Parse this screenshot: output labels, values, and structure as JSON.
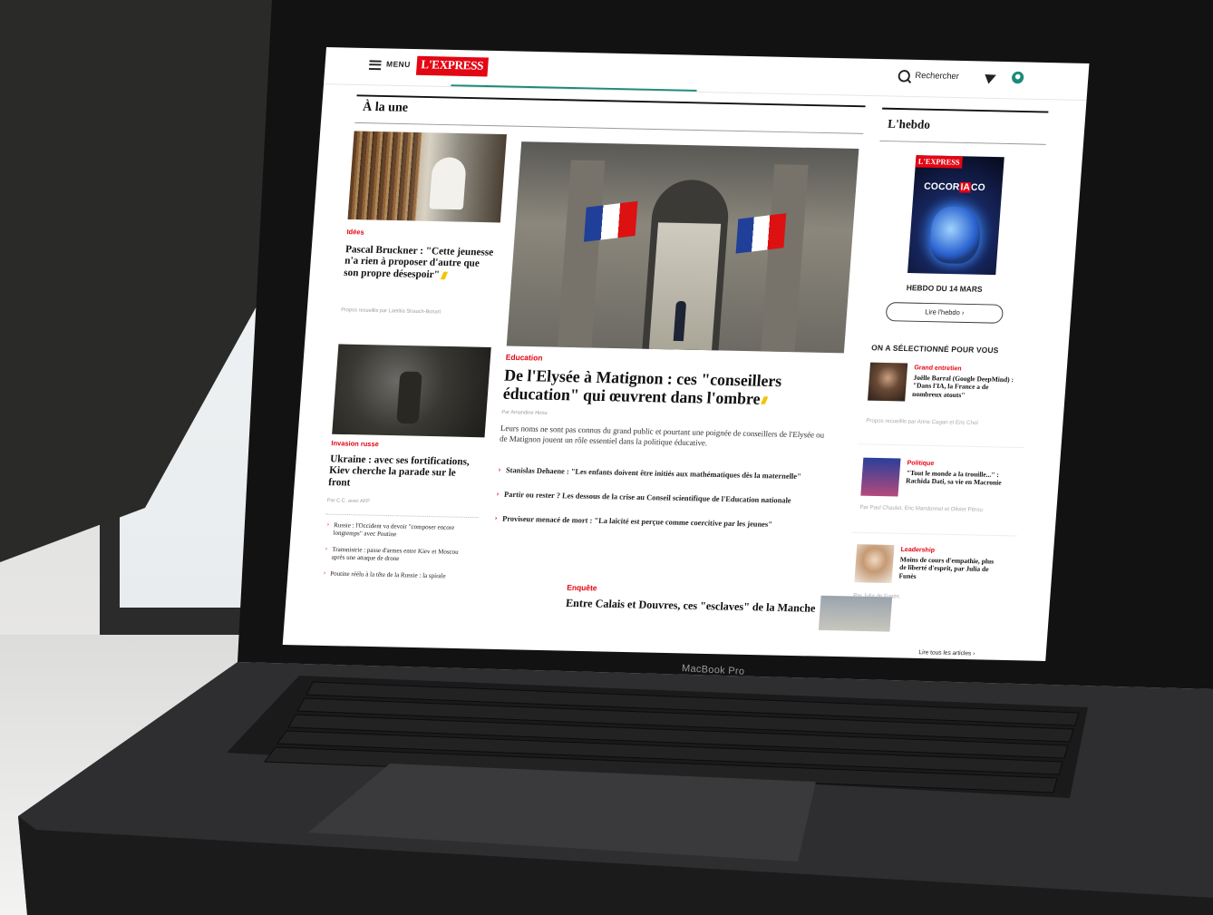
{
  "header": {
    "menu_label": "MENU",
    "logo": "L'EXPRESS",
    "search_label": "Rechercher"
  },
  "section": {
    "title": "À la une"
  },
  "articles": {
    "idees": {
      "kicker": "Idées",
      "headline": "Pascal Bruckner : \"Cette jeunesse n'a rien à proposer d'autre que son propre désespoir\"",
      "byline": "Propos recueillis par Laetitia Strauch-Bonart"
    },
    "education": {
      "kicker": "Education",
      "headline": "De l'Elysée à Matignon : ces \"conseillers éducation\" qui œuvrent dans l'ombre",
      "byline": "Par Amandine Hirou",
      "lead": "Leurs noms ne sont pas connus du grand public et pourtant une poignée de conseillers de l'Elysée ou de Matignon jouent un rôle essentiel dans la politique éducative.",
      "related": [
        "Stanislas Dehaene : \"Les enfants doivent être initiés aux mathématiques dès la maternelle\"",
        "Partir ou rester ? Les dessous de la crise au Conseil scientifique de l'Education nationale",
        "Proviseur menacé de mort : \"La laïcité est perçue comme coercitive par les jeunes\""
      ]
    },
    "ukraine": {
      "kicker": "Invasion russe",
      "headline": "Ukraine : avec ses fortifications, Kiev cherche la parade sur le front",
      "byline": "Par C.C. avec AFP",
      "related": [
        "Russie : l'Occident va devoir \"composer encore longtemps\" avec Poutine",
        "Transnistrie : passe d'armes entre Kiev et Moscou après une attaque de drone",
        "Poutine réélu à la tête de la Russie : la spirale"
      ]
    },
    "enquete": {
      "kicker": "Enquête",
      "headline": "Entre Calais et Douvres, ces \"esclaves\" de la Manche"
    }
  },
  "sidebar": {
    "title": "L'hebdo",
    "cover_logo": "L'EXPRESS",
    "cover_title_a": "COCOR",
    "cover_title_b": "IA",
    "cover_title_c": "CO",
    "issue_label": "HEBDO DU 14 MARS",
    "read_button": "Lire l'hebdo  ›",
    "selected_title": "ON A SÉLECTIONNÉ POUR VOUS",
    "items": [
      {
        "kicker": "Grand entretien",
        "headline": "Joëlle Barral (Google DeepMind) : \"Dans l'IA, la France a de nombreux atouts\"",
        "byline": "Propos recueillis par Anne Cagan et Eric Chol"
      },
      {
        "kicker": "Politique",
        "headline": "\"Tout le monde a la trouille...\" : Rachida Dati, sa vie en Macronie",
        "byline": "Par Paul Chaulet, Eric Mandonnet et Olivier Pérou"
      },
      {
        "kicker": "Leadership",
        "headline": "Moins de cours d'empathie, plus de liberté d'esprit, par Julia de Funès",
        "byline": "Par Julia de Funès"
      }
    ],
    "all_link": "Lire tous les articles  ›"
  },
  "device": {
    "bezel_label": "MacBook Pro"
  }
}
